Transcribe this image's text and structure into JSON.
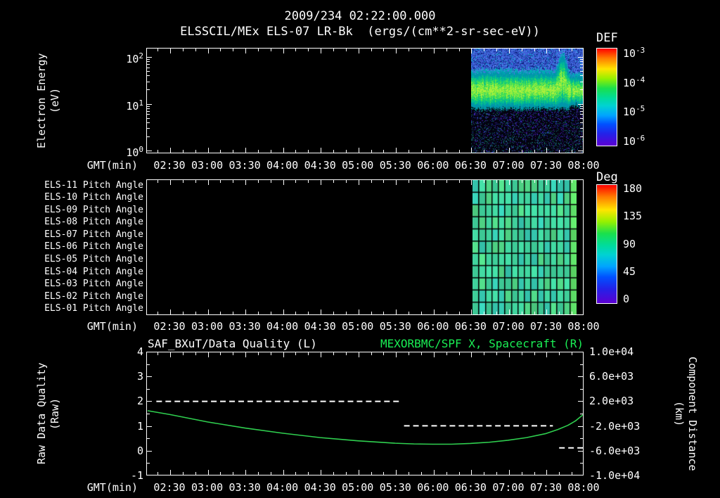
{
  "header": {
    "title_datetime": "2009/234 02:22:00.000",
    "title_instrument": "ELSSCIL/MEx ELS-07 LR-Bk  (ergs/(cm**2-sr-sec-eV))"
  },
  "time_axis": {
    "label": "GMT(min)",
    "ticks": [
      "02:30",
      "03:00",
      "03:30",
      "04:00",
      "04:30",
      "05:00",
      "05:30",
      "06:00",
      "06:30",
      "07:00",
      "07:30",
      "08:00"
    ]
  },
  "energy_panel": {
    "ylabel_line1": "Electron Energy",
    "ylabel_line2": "(eV)",
    "ytick_exponents": [
      "2",
      "1",
      "0"
    ],
    "colorbar_title": "DEF",
    "colorbar_tick_exponents": [
      "-3",
      "-4",
      "-5",
      "-6"
    ]
  },
  "pitch_panel": {
    "row_labels": [
      "ELS-11 Pitch Angle",
      "ELS-10 Pitch Angle",
      "ELS-09 Pitch Angle",
      "ELS-08 Pitch Angle",
      "ELS-07 Pitch Angle",
      "ELS-06 Pitch Angle",
      "ELS-05 Pitch Angle",
      "ELS-04 Pitch Angle",
      "ELS-03 Pitch Angle",
      "ELS-02 Pitch Angle",
      "ELS-01 Pitch Angle"
    ],
    "colorbar_title": "Deg",
    "colorbar_ticks": [
      "180",
      "135",
      "90",
      "45",
      "0"
    ]
  },
  "quality_panel": {
    "title_left": "SAF_BXuT/Data Quality (L)",
    "title_right": "MEXORBMC/SPF X, Spacecraft (R)",
    "ylabel_left_line1": "Raw Data Quality",
    "ylabel_left_line2": "(Raw)",
    "ylabel_right_line1": "Component Distance",
    "ylabel_right_line2": "(km)",
    "left_ticks": [
      "4",
      "3",
      "2",
      "1",
      "0",
      "-1"
    ],
    "right_ticks": [
      "1.0e+04",
      "6.0e+03",
      "2.0e+03",
      "-2.0e+03",
      "-6.0e+03",
      "-1.0e+04"
    ]
  },
  "colors": {
    "background": "#000000",
    "foreground": "#ffffff",
    "green_accent": "#1aef55",
    "curve_green": "#2fcf4f",
    "rainbow_stops": [
      "#ff0000 0%",
      "#ff7b00 10%",
      "#ffe400 21%",
      "#96f000 31%",
      "#1ae04c 41%",
      "#00dc9b 51%",
      "#00d2d2 59%",
      "#00a4ff 69%",
      "#0050ff 78%",
      "#2421e8 88%",
      "#5c00d2 100%"
    ]
  },
  "chart_data": [
    {
      "type": "heatmap",
      "panel": "electron-energy-spectrogram",
      "title": "ELSSCIL/MEx ELS-07 LR-Bk",
      "units": "ergs/(cm**2-sr-sec-eV)",
      "xlabel": "GMT(min)",
      "x_ticks": [
        "02:30",
        "03:00",
        "03:30",
        "04:00",
        "04:30",
        "05:00",
        "05:30",
        "06:00",
        "06:30",
        "07:00",
        "07:30",
        "08:00"
      ],
      "ylabel": "Electron Energy (eV)",
      "y_scale": "log",
      "y_range": [
        1,
        150
      ],
      "colorbar": {
        "title": "DEF",
        "tick_values": [
          "1e-3",
          "1e-4",
          "1e-5",
          "1e-6"
        ]
      },
      "coverage": {
        "start": "06:30",
        "end": "08:00",
        "note": "black / no data before 06:30"
      },
      "features": {
        "intense_band_eV": [
          8,
          45
        ],
        "band_level": "~1e-4 (green)",
        "above_band": "~1e-5 (blue noise)",
        "below_band": "~1e-6 (dark with purple speckles)",
        "spike": {
          "time": "07:43",
          "peak_eV": 110
        }
      },
      "seed": 20090234
    },
    {
      "type": "heatmap",
      "panel": "pitch-angles",
      "rows": [
        "ELS-11 Pitch Angle",
        "ELS-10 Pitch Angle",
        "ELS-09 Pitch Angle",
        "ELS-08 Pitch Angle",
        "ELS-07 Pitch Angle",
        "ELS-06 Pitch Angle",
        "ELS-05 Pitch Angle",
        "ELS-04 Pitch Angle",
        "ELS-03 Pitch Angle",
        "ELS-02 Pitch Angle",
        "ELS-01 Pitch Angle"
      ],
      "xlabel": "GMT(min)",
      "colorbar": {
        "title": "Deg",
        "tick_values": [
          180,
          135,
          90,
          45,
          0
        ]
      },
      "coverage": {
        "start": "06:30",
        "end": "07:54"
      },
      "typical_value_deg": 95,
      "right_columns_value_deg": 110,
      "seed": 4177
    },
    {
      "type": "line",
      "panel": "data-quality-and-spacecraft-distance",
      "titles": {
        "left": "SAF_BXuT/Data Quality (L)",
        "right": "MEXORBMC/SPF X, Spacecraft (R)"
      },
      "xlabel": "GMT(min)",
      "y_left": {
        "label": "Raw Data Quality (Raw)",
        "range": [
          -1,
          4
        ]
      },
      "y_right": {
        "label": "Component Distance (km)",
        "range": [
          -10000,
          10000
        ]
      },
      "series": [
        {
          "name": "MEXORBMC/SPF X, Spacecraft",
          "axis": "left-scale equivalent",
          "color": "green",
          "style": "solid",
          "points": [
            [
              "02:12",
              1.62
            ],
            [
              "02:30",
              1.46
            ],
            [
              "03:00",
              1.16
            ],
            [
              "03:30",
              0.91
            ],
            [
              "04:00",
              0.7
            ],
            [
              "04:30",
              0.52
            ],
            [
              "05:00",
              0.39
            ],
            [
              "05:30",
              0.29
            ],
            [
              "05:45",
              0.26
            ],
            [
              "06:00",
              0.25
            ],
            [
              "06:15",
              0.25
            ],
            [
              "06:30",
              0.28
            ],
            [
              "06:45",
              0.33
            ],
            [
              "07:00",
              0.41
            ],
            [
              "07:15",
              0.52
            ],
            [
              "07:30",
              0.68
            ],
            [
              "07:40",
              0.85
            ],
            [
              "07:48",
              1.02
            ],
            [
              "07:54",
              1.2
            ],
            [
              "08:00",
              1.45
            ]
          ]
        },
        {
          "name": "SAF_BXuT Data Quality",
          "color": "white",
          "style": "dashed",
          "segments": [
            {
              "value": 2,
              "from": "02:19",
              "to": "05:35"
            },
            {
              "value": 1,
              "from": "05:37",
              "to": "07:36"
            },
            {
              "value": 0.1,
              "from": "07:41",
              "to": "08:00"
            }
          ]
        }
      ]
    }
  ]
}
